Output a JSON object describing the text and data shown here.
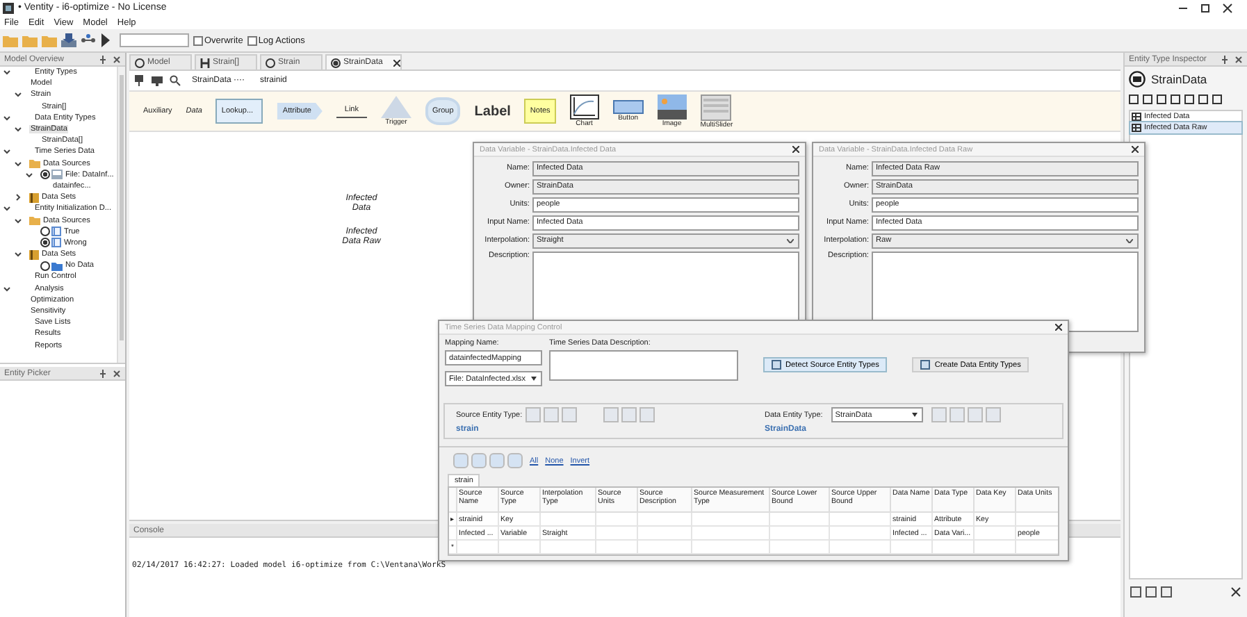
{
  "window": {
    "title": "• Ventity - i6-optimize - No License"
  },
  "menu": [
    "File",
    "Edit",
    "View",
    "Model",
    "Help"
  ],
  "toolbar": {
    "options": [
      {
        "label": "Overwrite",
        "checked": false
      },
      {
        "label": "Log Actions",
        "checked": false
      }
    ]
  },
  "model_overview": {
    "title": "Model Overview",
    "tree": [
      {
        "label": "Entity Types",
        "expanded": true,
        "selected": false,
        "children": [
          {
            "label": "Model",
            "selected": false
          },
          {
            "label": "Strain",
            "expanded": true,
            "selected": false,
            "children": [
              {
                "label": "Strain[]",
                "selected": false
              }
            ]
          }
        ]
      },
      {
        "label": "Data Entity Types",
        "expanded": true,
        "selected": false,
        "children": [
          {
            "label": "StrainData",
            "expanded": true,
            "selected": true,
            "children": [
              {
                "label": "StrainData[]",
                "selected": false
              }
            ]
          }
        ]
      },
      {
        "label": "Time Series Data",
        "expanded": true,
        "selected": false,
        "children": [
          {
            "label": "Data Sources",
            "kind": "folder",
            "expanded": true,
            "selected": false,
            "children": [
              {
                "label": "File: DataInf...",
                "kind": "file",
                "checked": true,
                "expanded": true,
                "selected": false,
                "children": [
                  {
                    "label": "datainfec...",
                    "selected": false
                  }
                ]
              }
            ]
          },
          {
            "label": "Data Sets",
            "kind": "sets",
            "expanded": false,
            "selected": false
          }
        ]
      },
      {
        "label": "Entity Initialization D...",
        "expanded": true,
        "selected": false,
        "children": [
          {
            "label": "Data Sources",
            "kind": "folder",
            "expanded": true,
            "selected": false,
            "children": [
              {
                "label": "True",
                "kind": "sheet",
                "checked": false,
                "selected": false
              },
              {
                "label": "Wrong",
                "kind": "sheet",
                "checked": true,
                "selected": false
              }
            ]
          },
          {
            "label": "Data Sets",
            "kind": "sets",
            "expanded": true,
            "selected": false,
            "children": [
              {
                "label": "No Data",
                "kind": "bluefolder",
                "checked": false,
                "selected": false
              }
            ]
          }
        ]
      },
      {
        "label": "Run Control",
        "selected": false
      },
      {
        "label": "Analysis",
        "expanded": true,
        "selected": false,
        "children": [
          {
            "label": "Optimization",
            "selected": false
          },
          {
            "label": "Sensitivity",
            "selected": false
          }
        ]
      },
      {
        "label": "Save Lists",
        "selected": false
      },
      {
        "label": "Results",
        "selected": false
      },
      {
        "label": "Reports",
        "selected": false
      }
    ]
  },
  "entity_picker": {
    "title": "Entity Picker"
  },
  "tabs": [
    {
      "label": "Model",
      "kind": "circle",
      "selected": false,
      "closable": false
    },
    {
      "label": "Strain[]",
      "kind": "array",
      "selected": false,
      "closable": false
    },
    {
      "label": "Strain",
      "kind": "circle",
      "selected": false,
      "closable": false
    },
    {
      "label": "StrainData",
      "kind": "data",
      "selected": true,
      "closable": true
    }
  ],
  "breadcrumb": [
    "StrainData ····",
    "strainid"
  ],
  "palette": [
    {
      "label": "Auxiliary",
      "kind": "plain"
    },
    {
      "label": "Data",
      "kind": "italic"
    },
    {
      "label": "Lookup...",
      "kind": "lookup"
    },
    {
      "label": "Attribute",
      "kind": "attribute"
    },
    {
      "label": "Link",
      "kind": "link"
    },
    {
      "label": "Trigger",
      "kind": "trigger"
    },
    {
      "label": "Group",
      "kind": "group"
    },
    {
      "label": "Label",
      "kind": "label"
    },
    {
      "label": "Notes",
      "kind": "notes"
    },
    {
      "label": "Chart",
      "kind": "chart"
    },
    {
      "label": "Button",
      "kind": "button"
    },
    {
      "label": "Image",
      "kind": "image"
    },
    {
      "label": "MultiSlider",
      "kind": "slider"
    }
  ],
  "canvas": {
    "nodes": [
      {
        "label": "Infected Data"
      },
      {
        "label": "Infected Data Raw"
      }
    ]
  },
  "variable_windows": [
    {
      "title": "Data Variable - StrainData.Infected Data",
      "fields": [
        {
          "label": "Name:",
          "value": "Infected Data",
          "kind": "readonly"
        },
        {
          "label": "Owner:",
          "value": "StrainData",
          "kind": "readonly"
        },
        {
          "label": "Units:",
          "value": "people",
          "kind": "text"
        },
        {
          "label": "Input Name:",
          "value": "Infected Data",
          "kind": "text"
        },
        {
          "label": "Interpolation:",
          "value": "Straight",
          "kind": "select"
        },
        {
          "label": "Description:",
          "kind": "textarea"
        }
      ]
    },
    {
      "title": "Data Variable - StrainData.Infected Data Raw",
      "fields": [
        {
          "label": "Name:",
          "value": "Infected Data Raw",
          "kind": "readonly"
        },
        {
          "label": "Owner:",
          "value": "StrainData",
          "kind": "readonly"
        },
        {
          "label": "Units:",
          "value": "people",
          "kind": "text"
        },
        {
          "label": "Input Name:",
          "value": "Infected Data",
          "kind": "text"
        },
        {
          "label": "Interpolation:",
          "value": "Raw",
          "kind": "select"
        },
        {
          "label": "Description:",
          "kind": "textarea"
        }
      ]
    }
  ],
  "mapping_window": {
    "title": "Time Series Data Mapping Control",
    "mapping_name_label": "Mapping Name:",
    "mapping_name": "datainfectedMapping",
    "file": "File: DataInfected.xlsx",
    "description_label": "Time Series Data Description:",
    "buttons": [
      "Detect Source Entity Types",
      "Create Data Entity Types"
    ],
    "source_label": "Source Entity Type:",
    "source_entity": "strain",
    "data_label": "Data Entity Type:",
    "data_entity_select": "StrainData",
    "data_entity": "StrainData",
    "links": [
      "All",
      "None",
      "Invert"
    ],
    "table_tab": "strain",
    "columns": [
      "Source Name",
      "Source Type",
      "Interpolation Type",
      "Source Units",
      "Source Description",
      "Source Measurement Type",
      "Source Lower Bound",
      "Source Upper Bound",
      "Data Name",
      "Data Type",
      "Data Key",
      "Data Units"
    ],
    "rows": [
      {
        "marker": "▸",
        "cells": [
          "strainid",
          "Key",
          "",
          "",
          "",
          "",
          "",
          "",
          "strainid",
          "Attribute",
          "Key",
          ""
        ]
      },
      {
        "cells": [
          "Infected ...",
          "Variable",
          "Straight",
          "",
          "",
          "",
          "",
          "",
          "Infected ...",
          "Data Vari...",
          "",
          "people"
        ]
      },
      {
        "marker": "*",
        "cells": [
          "",
          "",
          "",
          "",
          "",
          "",
          "",
          "",
          "",
          "",
          "",
          ""
        ]
      }
    ]
  },
  "inspector": {
    "title": "Entity Type Inspector",
    "entity": "StrainData",
    "items": [
      {
        "label": "Infected Data",
        "selected": false
      },
      {
        "label": "Infected Data Raw",
        "selected": true
      }
    ]
  },
  "console": {
    "title": "Console",
    "lines": [
      "02/14/2017 16:42:27: Loaded model i6-optimize from C:\\Ventana\\WorkS"
    ]
  }
}
